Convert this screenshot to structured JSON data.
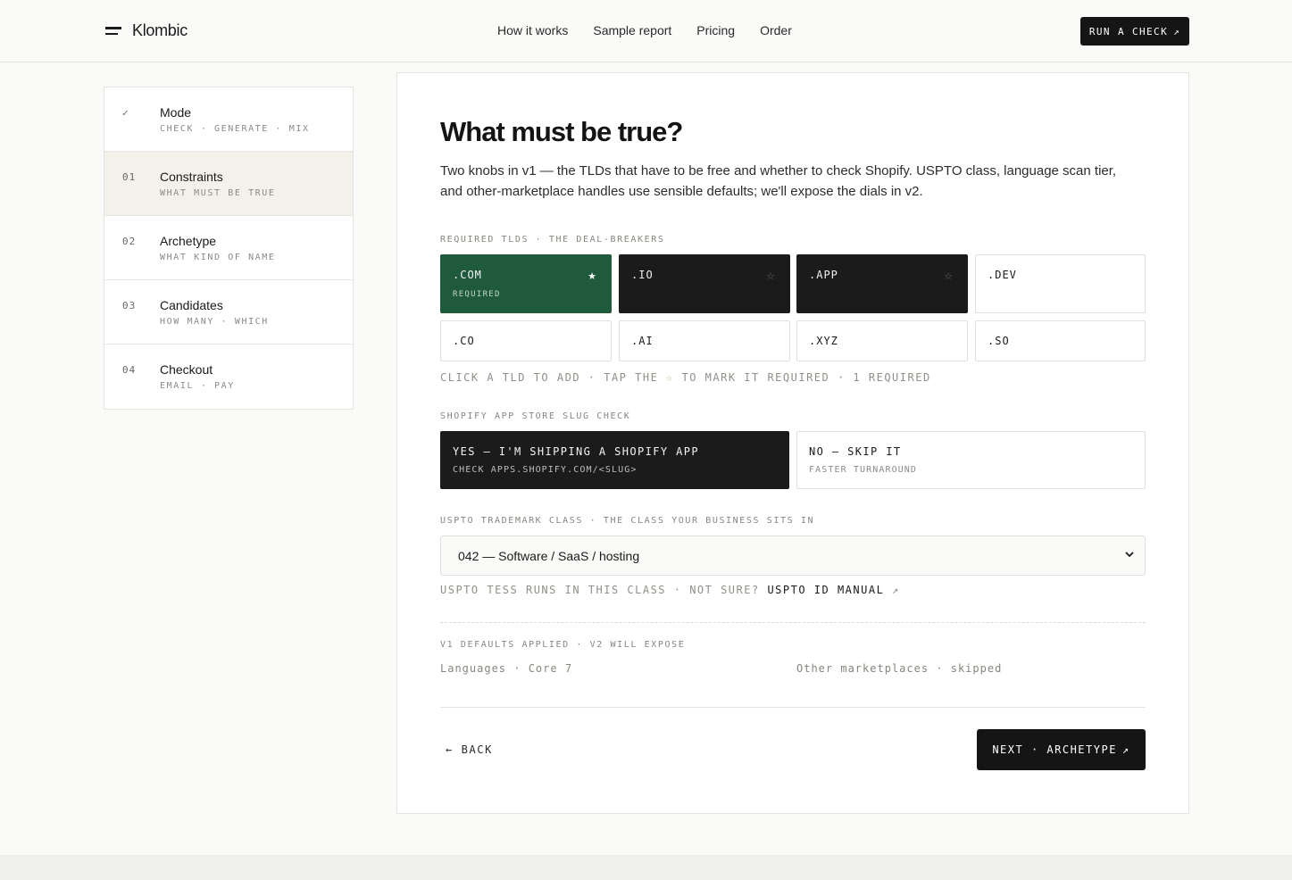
{
  "header": {
    "brand": "Klombic",
    "nav": [
      "How it works",
      "Sample report",
      "Pricing",
      "Order"
    ],
    "cta_label": "RUN A CHECK",
    "cta_icon": "↗"
  },
  "steps": [
    {
      "num": "✓",
      "title": "Mode",
      "sub": "CHECK · GENERATE · MIX"
    },
    {
      "num": "01",
      "title": "Constraints",
      "sub": "WHAT MUST BE TRUE"
    },
    {
      "num": "02",
      "title": "Archetype",
      "sub": "WHAT KIND OF NAME"
    },
    {
      "num": "03",
      "title": "Candidates",
      "sub": "HOW MANY · WHICH"
    },
    {
      "num": "04",
      "title": "Checkout",
      "sub": "EMAIL · PAY"
    }
  ],
  "main": {
    "title": "What must be true?",
    "lead": "Two knobs in v1 — the TLDs that have to be free and whether to check Shopify. USPTO class, language scan tier, and other-marketplace handles use sensible defaults; we'll expose the dials in v2.",
    "tld_label": "REQUIRED TLDS · THE DEAL-BREAKERS",
    "tlds": [
      {
        "name": ".COM",
        "star": "★",
        "note": "REQUIRED"
      },
      {
        "name": ".IO",
        "star": "☆"
      },
      {
        "name": ".APP",
        "star": "☆"
      },
      {
        "name": ".DEV"
      },
      {
        "name": ".CO"
      },
      {
        "name": ".AI"
      },
      {
        "name": ".XYZ"
      },
      {
        "name": ".SO"
      }
    ],
    "tld_hint_a": "CLICK A TLD TO ADD · TAP THE ",
    "tld_hint_star": "☆",
    "tld_hint_b": " TO MARK IT REQUIRED · 1 REQUIRED",
    "shopify_label": "SHOPIFY APP STORE SLUG CHECK",
    "shopify_yes_title": "YES — I'M SHIPPING A SHOPIFY APP",
    "shopify_yes_sub": "CHECK APPS.SHOPIFY.COM/<SLUG>",
    "shopify_no_title": "NO — SKIP IT",
    "shopify_no_sub": "FASTER TURNAROUND",
    "uspto_label": "USPTO TRADEMARK CLASS · THE CLASS YOUR BUSINESS SITS IN",
    "uspto_value": "042 — Software / SaaS / hosting",
    "uspto_hint": "USPTO TESS RUNS IN THIS CLASS · NOT SURE? ",
    "uspto_link": "USPTO ID MANUAL",
    "uspto_link_icon": "↗",
    "defaults_label": "V1 DEFAULTS APPLIED · V2 WILL EXPOSE",
    "defaults_languages": "Languages · Core 7",
    "defaults_marketplaces": "Other marketplaces · skipped",
    "back_label": "← BACK",
    "next_label": "NEXT · ARCHETYPE",
    "next_icon": "↗"
  },
  "colors": {
    "accent_green": "#1f5a3c",
    "dark": "#1b1b1b",
    "active_step_bg": "#f3f1ea"
  }
}
